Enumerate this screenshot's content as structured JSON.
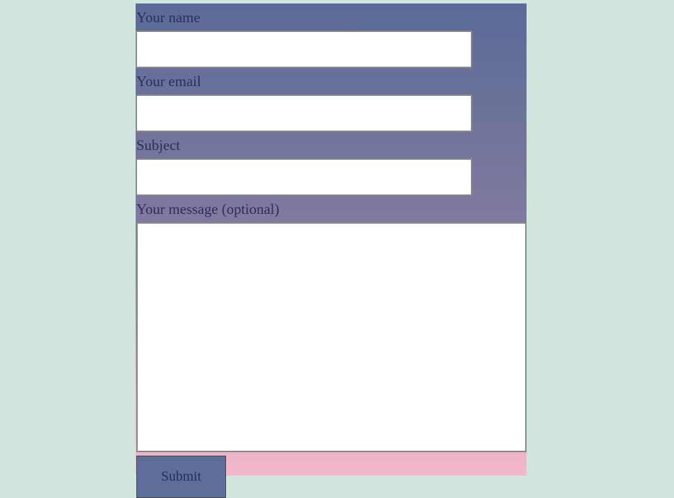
{
  "form": {
    "name": {
      "label": "Your name",
      "value": ""
    },
    "email": {
      "label": "Your email",
      "value": ""
    },
    "subject": {
      "label": "Subject",
      "value": ""
    },
    "message": {
      "label": "Your message (optional)",
      "value": ""
    },
    "submit_label": "Submit"
  }
}
